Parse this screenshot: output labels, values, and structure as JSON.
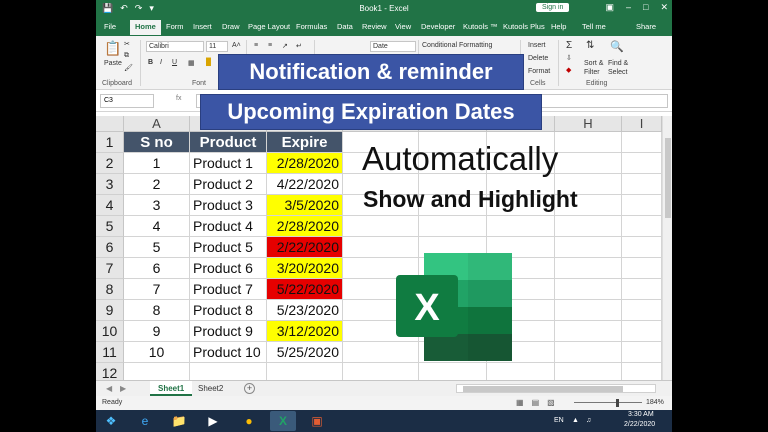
{
  "window": {
    "title": "Book1 - Excel",
    "signin": "Sign in",
    "qat_icons": [
      "save-icon",
      "undo-icon",
      "redo-icon",
      "customize-icon"
    ]
  },
  "tabs": [
    "File",
    "Home",
    "Form",
    "Insert",
    "Draw",
    "Page Layout",
    "Formulas",
    "Data",
    "Review",
    "View",
    "Developer",
    "Kutools ™",
    "Kutools Plus",
    "Help",
    "Tell me",
    "Share"
  ],
  "ribbon": {
    "paste": "Paste",
    "clipboard": "Clipboard",
    "font_name": "Calibri",
    "font_size": "11",
    "font_group": "Font",
    "number_format": "Date",
    "cond_format": "Conditional Formatting",
    "insert": "Insert",
    "delete": "Delete",
    "format": "Format",
    "cells": "Cells",
    "sort": "Sort &",
    "filter": "Filter",
    "find": "Find &",
    "select": "Select",
    "editing": "Editing"
  },
  "formula_bar": {
    "name_box": "C3",
    "fx": "fx",
    "value": ""
  },
  "columns": [
    "A",
    "",
    "",
    "",
    "",
    "",
    "H",
    "I"
  ],
  "headers": [
    "S no",
    "Product",
    "Expire"
  ],
  "rows": [
    {
      "n": "1",
      "sno": "1",
      "product": "Product 1",
      "expire": "2/28/2020",
      "hl": "yellow"
    },
    {
      "n": "2",
      "sno": "2",
      "product": "Product 2",
      "expire": "4/22/2020",
      "hl": ""
    },
    {
      "n": "3",
      "sno": "3",
      "product": "Product 3",
      "expire": "3/5/2020",
      "hl": "yellow"
    },
    {
      "n": "4",
      "sno": "4",
      "product": "Product 4",
      "expire": "2/28/2020",
      "hl": "yellow"
    },
    {
      "n": "5",
      "sno": "5",
      "product": "Product 5",
      "expire": "2/22/2020",
      "hl": "red"
    },
    {
      "n": "6",
      "sno": "6",
      "product": "Product 6",
      "expire": "3/20/2020",
      "hl": "yellow"
    },
    {
      "n": "7",
      "sno": "7",
      "product": "Product 7",
      "expire": "5/22/2020",
      "hl": "red"
    },
    {
      "n": "8",
      "sno": "8",
      "product": "Product 8",
      "expire": "5/23/2020",
      "hl": ""
    },
    {
      "n": "9",
      "sno": "9",
      "product": "Product 9",
      "expire": "3/12/2020",
      "hl": "yellow"
    },
    {
      "n": "10",
      "sno": "10",
      "product": "Product 10",
      "expire": "5/25/2020",
      "hl": ""
    }
  ],
  "row_numbers": [
    "1",
    "2",
    "3",
    "4",
    "5",
    "6",
    "7",
    "8",
    "9",
    "10",
    "11",
    "12"
  ],
  "overlay": {
    "banner1": "Notification & reminder",
    "banner2": "Upcoming Expiration Dates",
    "automatically": "Automatically",
    "show_highlight": "Show and Highlight",
    "logo_letter": "X"
  },
  "sheets": [
    "Sheet1",
    "Sheet2"
  ],
  "status": {
    "ready": "Ready",
    "zoom": "184%"
  },
  "taskbar": {
    "lang": "EN",
    "time": "3:30 AM",
    "date": "2/22/2020",
    "apps": [
      "windows-start-icon",
      "ie-icon",
      "folder-icon",
      "chrome-icon",
      "excel-icon",
      "media-icon"
    ]
  },
  "colors": {
    "excel_green": "#217346",
    "header_fill": "#44546a",
    "yellow": "#ffff00",
    "red": "#e60000",
    "banner": "#3b55a5"
  }
}
